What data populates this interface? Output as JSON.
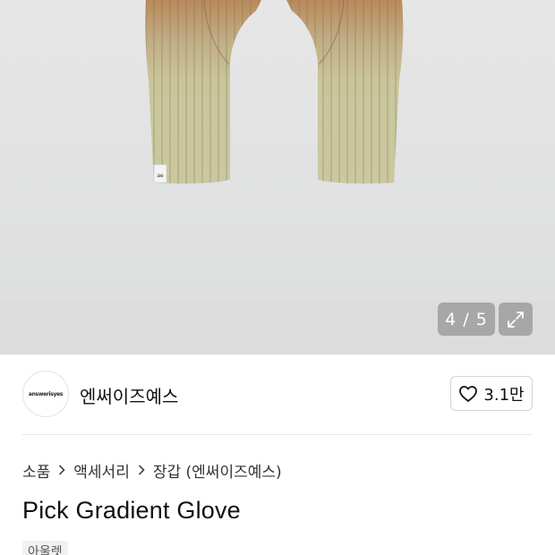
{
  "gallery": {
    "pager_text": "4 / 5",
    "glove_label_text": "ae",
    "colors": {
      "glove_top": "#b98a5c",
      "glove_bottom": "#c9c69c",
      "background": "#e3e3e3"
    }
  },
  "seller": {
    "avatar_text": "answerisyes",
    "name": "엔써이즈예스",
    "likes": "3.1만"
  },
  "breadcrumb": [
    "소품",
    "액세서리",
    "장갑 (엔써이즈예스)"
  ],
  "product": {
    "title": "Pick Gradient Glove",
    "tag": "아울렛"
  }
}
